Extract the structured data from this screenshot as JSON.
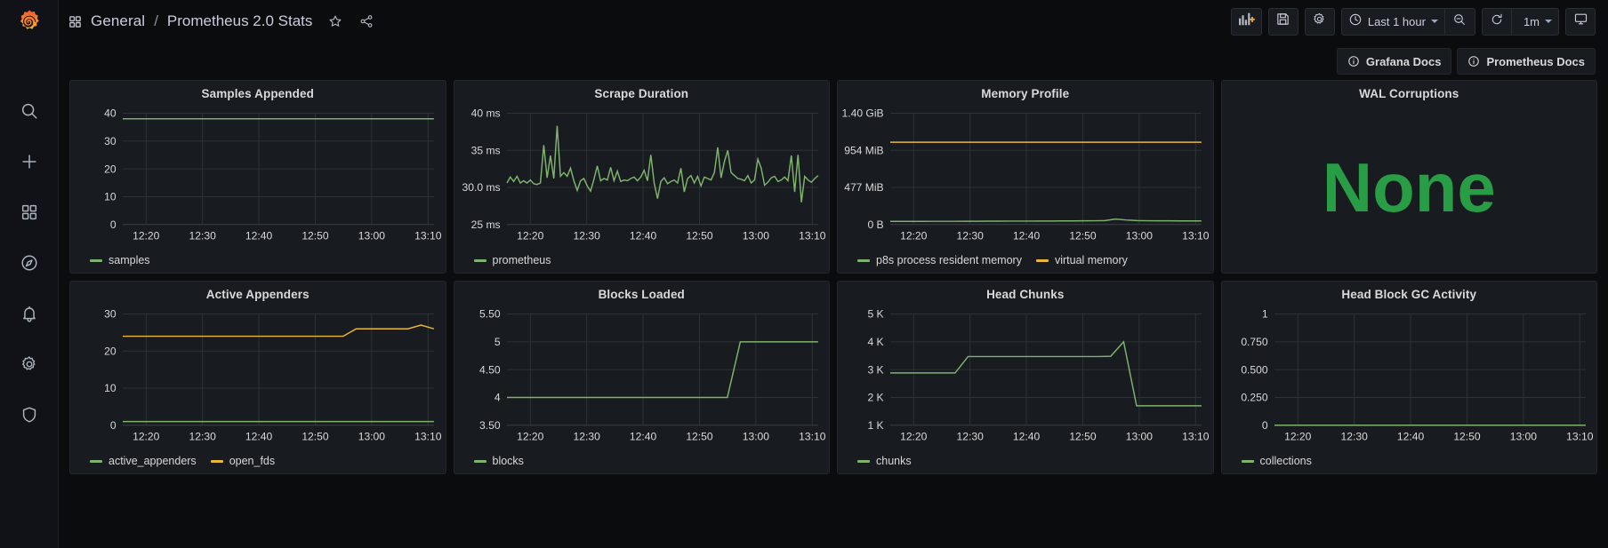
{
  "app": {
    "logo_icon": "grafana-logo-icon",
    "logo_colors": [
      "#f05a28",
      "#fbb03b"
    ]
  },
  "sidebar": {
    "items": [
      {
        "icon": "search-icon",
        "label": "Search"
      },
      {
        "icon": "plus-icon",
        "label": "Create"
      },
      {
        "icon": "dashboards-icon",
        "label": "Dashboards"
      },
      {
        "icon": "compass-icon",
        "label": "Explore"
      },
      {
        "icon": "bell-icon",
        "label": "Alerting"
      },
      {
        "icon": "gear-icon",
        "label": "Configuration"
      },
      {
        "icon": "shield-icon",
        "label": "Server Admin"
      }
    ]
  },
  "topnav": {
    "breadcrumb_icon": "dashboards-icon",
    "folder": "General",
    "separator": "/",
    "title": "Prometheus 2.0 Stats",
    "star_icon": "star-icon",
    "share_icon": "share-icon",
    "buttons": [
      {
        "name": "add-panel-button",
        "icon": "add-panel-icon"
      },
      {
        "name": "save-dashboard-button",
        "icon": "save-icon"
      },
      {
        "name": "dashboard-settings-button",
        "icon": "gear-icon"
      }
    ],
    "time_picker": {
      "icon": "clock-icon",
      "label": "Last 1 hour",
      "caret": "chevron-down-icon"
    },
    "zoom_out": {
      "name": "zoom-out-button",
      "icon": "zoom-out-icon"
    },
    "refresh": {
      "name": "refresh-button",
      "icon": "refresh-icon"
    },
    "refresh_interval": {
      "label": "1m",
      "caret": "chevron-down-icon"
    },
    "kiosk": {
      "name": "kiosk-mode-button",
      "icon": "tv-icon"
    }
  },
  "docs_links": [
    {
      "icon": "info-icon",
      "label": "Grafana Docs"
    },
    {
      "icon": "info-icon",
      "label": "Prometheus Docs"
    }
  ],
  "colors": {
    "green": "#7eb26d",
    "yellow": "#eab839",
    "stat_green": "#299c46",
    "panel_bg": "#181b1f",
    "grid": "#2c3235"
  },
  "chart_data": [
    {
      "panel_index": 0,
      "type": "line",
      "title": "Samples Appended",
      "xlabel": "",
      "ylabel": "",
      "x_ticks": [
        "12:20",
        "12:30",
        "12:40",
        "12:50",
        "13:00",
        "13:10"
      ],
      "y_ticks": [
        "0",
        "10",
        "20",
        "30",
        "40"
      ],
      "ylim": [
        0,
        40
      ],
      "grid": true,
      "legend_position": "bottom",
      "series": [
        {
          "name": "samples",
          "color": "#7eb26d",
          "values": [
            38,
            38,
            38,
            38,
            38,
            38,
            38,
            38,
            38,
            38,
            38,
            38,
            38,
            38,
            38,
            38,
            38,
            38,
            38,
            38,
            38
          ]
        }
      ]
    },
    {
      "panel_index": 1,
      "type": "line",
      "title": "Scrape Duration",
      "xlabel": "",
      "ylabel": "",
      "x_ticks": [
        "12:20",
        "12:30",
        "12:40",
        "12:50",
        "13:00",
        "13:10"
      ],
      "y_ticks": [
        "25 ms",
        "30.0 ms",
        "35 ms",
        "40 ms"
      ],
      "ylim": [
        25,
        40
      ],
      "grid": true,
      "legend_position": "bottom",
      "series": [
        {
          "name": "prometheus",
          "color": "#7eb26d",
          "values": [
            30.6,
            31.4,
            30.8,
            31.5,
            30.6,
            30.9,
            30.6,
            31.0,
            30.5,
            30.4,
            30.6,
            35.7,
            31.3,
            34.3,
            31.2,
            38.3,
            31.5,
            32.0,
            31.5,
            32.6,
            30.9,
            29.6,
            30.9,
            31.2,
            30.2,
            29.5,
            31.1,
            32.9,
            30.9,
            31.2,
            31.0,
            32.7,
            30.9,
            32.2,
            30.8,
            31.0,
            30.9,
            31.2,
            31.4,
            30.9,
            31.4,
            32.3,
            30.9,
            34.4,
            30.6,
            28.5,
            30.8,
            31.3,
            30.5,
            30.8,
            31.0,
            30.6,
            32.6,
            29.4,
            31.2,
            31.6,
            30.6,
            31.5,
            30.2,
            31.4,
            31.2,
            31.0,
            32.0,
            35.4,
            31.3,
            33.5,
            35.0,
            32.0,
            31.6,
            31.2,
            31.1,
            30.9,
            31.6,
            30.6,
            31.0,
            33.8,
            32.6,
            30.3,
            30.7,
            31.3,
            31.5,
            30.8,
            31.0,
            31.4,
            30.9,
            34.3,
            29.4,
            34.4,
            28.0,
            31.5,
            31.0,
            30.7,
            31.2,
            31.6
          ]
        }
      ]
    },
    {
      "panel_index": 2,
      "type": "line",
      "title": "Memory Profile",
      "xlabel": "",
      "ylabel": "",
      "x_ticks": [
        "12:20",
        "12:30",
        "12:40",
        "12:50",
        "13:00",
        "13:10"
      ],
      "y_ticks": [
        "0 B",
        "477 MiB",
        "954 MiB",
        "1.40 GiB"
      ],
      "ylim": [
        0,
        1433
      ],
      "y_unit": "MiB",
      "grid": true,
      "legend_position": "bottom",
      "series": [
        {
          "name": "p8s process resident memory",
          "color": "#7eb26d",
          "values": [
            40,
            40,
            40,
            40,
            41,
            41,
            41,
            42,
            42,
            43,
            43,
            44,
            44,
            44,
            45,
            45,
            46,
            46,
            47,
            48,
            50,
            70,
            58,
            50,
            48,
            47,
            47,
            46,
            46,
            46
          ]
        },
        {
          "name": "virtual memory",
          "color": "#eab839",
          "values": [
            1060,
            1060,
            1060,
            1060,
            1060,
            1060,
            1060,
            1060,
            1060,
            1060,
            1060,
            1060,
            1060,
            1060,
            1060,
            1060,
            1060,
            1060,
            1060,
            1060,
            1060,
            1060,
            1060,
            1060,
            1060,
            1060,
            1060,
            1060,
            1060,
            1060
          ]
        }
      ]
    },
    {
      "panel_index": 3,
      "type": "stat",
      "title": "WAL Corruptions",
      "value": "None",
      "value_color": "#299c46"
    },
    {
      "panel_index": 4,
      "type": "line",
      "title": "Active Appenders",
      "xlabel": "",
      "ylabel": "",
      "x_ticks": [
        "12:20",
        "12:30",
        "12:40",
        "12:50",
        "13:00",
        "13:10"
      ],
      "y_ticks": [
        "0",
        "10",
        "20",
        "30"
      ],
      "ylim": [
        0,
        30
      ],
      "grid": true,
      "legend_position": "bottom",
      "series": [
        {
          "name": "active_appenders",
          "color": "#7eb26d",
          "values": [
            1,
            1,
            1,
            1,
            1,
            1,
            1,
            1,
            1,
            1,
            1,
            1,
            1,
            1,
            1,
            1,
            1,
            1,
            1,
            1,
            1,
            1,
            1,
            1,
            1
          ]
        },
        {
          "name": "open_fds",
          "color": "#eab839",
          "values": [
            24,
            24,
            24,
            24,
            24,
            24,
            24,
            24,
            24,
            24,
            24,
            24,
            24,
            24,
            24,
            24,
            24,
            24,
            26,
            26,
            26,
            26,
            26,
            27,
            26
          ]
        }
      ]
    },
    {
      "panel_index": 5,
      "type": "line",
      "title": "Blocks Loaded",
      "xlabel": "",
      "ylabel": "",
      "x_ticks": [
        "12:20",
        "12:30",
        "12:40",
        "12:50",
        "13:00",
        "13:10"
      ],
      "y_ticks": [
        "3.50",
        "4",
        "4.50",
        "5",
        "5.50"
      ],
      "ylim": [
        3.5,
        5.5
      ],
      "grid": true,
      "legend_position": "bottom",
      "series": [
        {
          "name": "blocks",
          "color": "#7eb26d",
          "values": [
            4,
            4,
            4,
            4,
            4,
            4,
            4,
            4,
            4,
            4,
            4,
            4,
            4,
            4,
            4,
            4,
            4,
            4,
            5,
            5,
            5,
            5,
            5,
            5,
            5
          ]
        }
      ]
    },
    {
      "panel_index": 6,
      "type": "line",
      "title": "Head Chunks",
      "xlabel": "",
      "ylabel": "",
      "x_ticks": [
        "12:20",
        "12:30",
        "12:40",
        "12:50",
        "13:00",
        "13:10"
      ],
      "y_ticks": [
        "1 K",
        "2 K",
        "3 K",
        "4 K",
        "5 K"
      ],
      "ylim": [
        1000,
        5000
      ],
      "grid": true,
      "legend_position": "bottom",
      "series": [
        {
          "name": "chunks",
          "color": "#7eb26d",
          "values": [
            2880,
            2880,
            2880,
            2880,
            2880,
            2880,
            3470,
            3470,
            3470,
            3470,
            3470,
            3470,
            3470,
            3470,
            3470,
            3470,
            3470,
            3480,
            4000,
            1700,
            1700,
            1700,
            1700,
            1700,
            1700
          ]
        }
      ]
    },
    {
      "panel_index": 7,
      "type": "line",
      "title": "Head Block GC Activity",
      "xlabel": "",
      "ylabel": "",
      "x_ticks": [
        "12:20",
        "12:30",
        "12:40",
        "12:50",
        "13:00",
        "13:10"
      ],
      "y_ticks": [
        "0",
        "0.250",
        "0.500",
        "0.750",
        "1"
      ],
      "ylim": [
        0,
        1
      ],
      "grid": true,
      "legend_position": "bottom",
      "series": [
        {
          "name": "collections",
          "color": "#7eb26d",
          "values": [
            0,
            0,
            0,
            0,
            0,
            0,
            0,
            0,
            0,
            0,
            0,
            0,
            0,
            0,
            0,
            0,
            0,
            0,
            0,
            0,
            0,
            0,
            0,
            0,
            0
          ]
        }
      ]
    }
  ]
}
